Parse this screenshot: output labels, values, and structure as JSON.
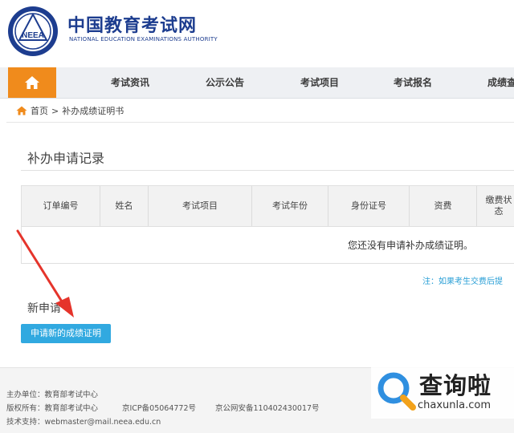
{
  "header": {
    "logo_text": "NEEA",
    "site_title": "中国教育考试网",
    "site_subtitle": "NATIONAL EDUCATION EXAMINATIONS AUTHORITY"
  },
  "nav": {
    "items": [
      "考试资讯",
      "公示公告",
      "考试项目",
      "考试报名",
      "成绩查"
    ]
  },
  "breadcrumb": {
    "home": "首页",
    "separator": ">",
    "current": "补办成绩证明书"
  },
  "records": {
    "title": "补办申请记录",
    "columns": [
      "订单编号",
      "姓名",
      "考试项目",
      "考试年份",
      "身份证号",
      "资费",
      "缴费状态"
    ],
    "empty_message": "您还没有申请补办成绩证明。"
  },
  "note": "注：如果考生交费后提",
  "new_application": {
    "label": "新申请",
    "button": "申请新的成绩证明"
  },
  "footer": {
    "line1": "主办单位：教育部考试中心",
    "line2a": "版权所有：教育部考试中心",
    "line2b": "京ICP备05064772号",
    "line2c": "京公网安备110402430017号",
    "line3": "技术支持：webmaster@mail.neea.edu.cn"
  },
  "watermark": {
    "title": "查询啦",
    "url": "chaxunla.com"
  },
  "colors": {
    "brand_blue": "#1d3d8f",
    "nav_home_orange": "#f08b1c",
    "button_blue": "#31a9e0",
    "arrow_red": "#e5342b"
  }
}
